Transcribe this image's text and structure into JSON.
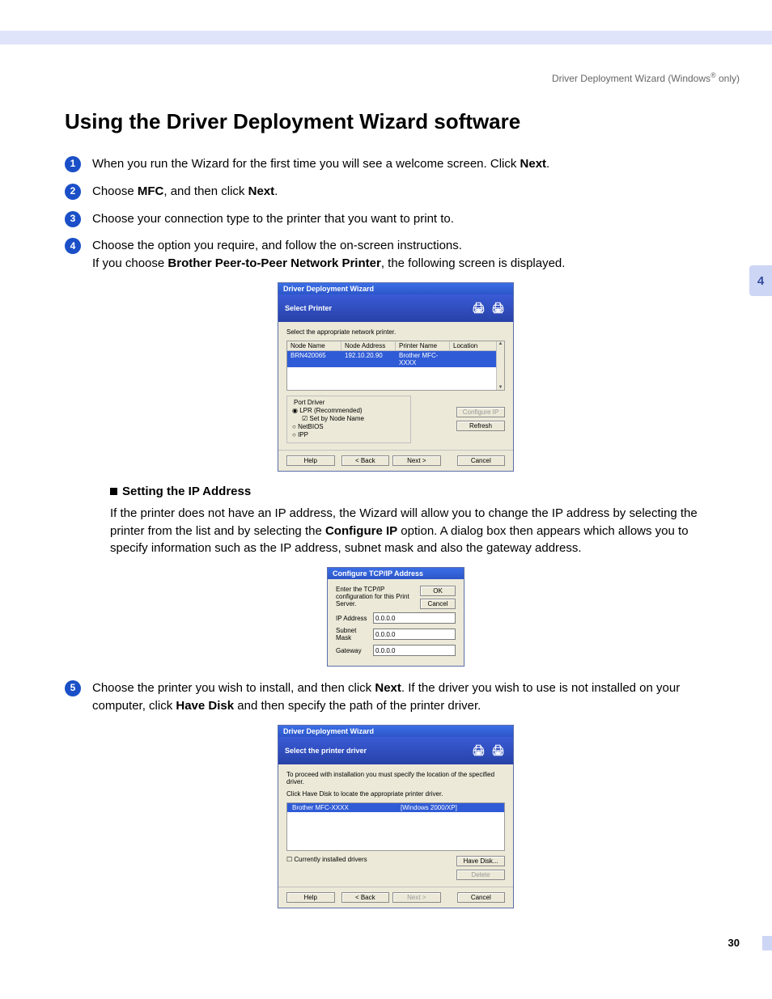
{
  "header": {
    "crumb_prefix": "Driver Deployment Wizard (Windows",
    "crumb_suffix": " only)",
    "reg": "®"
  },
  "title": "Using the Driver Deployment Wizard software",
  "steps": {
    "s1a": "When you run the Wizard for the first time you will see a welcome screen. Click ",
    "s1b": "Next",
    "s1c": ".",
    "s2a": "Choose ",
    "s2b": "MFC",
    "s2c": ", and then click ",
    "s2d": "Next",
    "s2e": ".",
    "s3": "Choose your connection type to the printer that you want to print to.",
    "s4a": "Choose the option you require, and follow the on-screen instructions.",
    "s4b": "If you choose ",
    "s4c": "Brother Peer-to-Peer Network Printer",
    "s4d": ", the following screen is displayed.",
    "s5a": "Choose the printer you wish to install, and then click ",
    "s5b": "Next",
    "s5c": ". If the driver you wish to use is not installed on your computer, click ",
    "s5d": "Have Disk",
    "s5e": " and then specify the path of the printer driver."
  },
  "sub": {
    "heading": "Setting the IP Address",
    "para_a": "If the printer does not have an IP address, the Wizard will allow you to change the IP address by selecting the printer from the list and by selecting the ",
    "para_b": "Configure IP",
    "para_c": " option. A dialog box then appears which allows you to specify information such as the IP address, subnet mask and also the gateway address."
  },
  "dlg1": {
    "title": "Driver Deployment Wizard",
    "banner": "Select Printer",
    "instr": "Select the appropriate network printer.",
    "cols": {
      "c1": "Node Name",
      "c2": "Node Address",
      "c3": "Printer Name",
      "c4": "Location"
    },
    "row": {
      "c1": "BRN420065",
      "c2": "192.10.20.90",
      "c3": "Brother   MFC-XXXX",
      "c4": ""
    },
    "fs": {
      "legend": "Port Driver",
      "o1": "LPR (Recommended)",
      "o2": "Set by Node Name",
      "o3": "NetBIOS",
      "o4": "IPP"
    },
    "btns": {
      "configip": "Configure IP",
      "refresh": "Refresh",
      "help": "Help",
      "back": "< Back",
      "next": "Next >",
      "cancel": "Cancel"
    }
  },
  "dlg2": {
    "title": "Configure TCP/IP Address",
    "msg": "Enter the TCP/IP configuration for this Print Server.",
    "ok": "OK",
    "cancel": "Cancel",
    "ip_lbl": "IP Address",
    "ip_val": "0.0.0.0",
    "sm_lbl": "Subnet Mask",
    "sm_val": "0.0.0.0",
    "gw_lbl": "Gateway",
    "gw_val": "0.0.0.0"
  },
  "dlg3": {
    "title": "Driver Deployment Wizard",
    "banner": "Select the printer driver",
    "instr1": "To proceed with installation you must specify the location of the specified driver.",
    "instr2": "Click Have Disk to locate the appropriate printer driver.",
    "row": {
      "c1": "Brother  MFC-XXXX",
      "c2": "[Windows 2000/XP]"
    },
    "chk": "Currently installed drivers",
    "btns": {
      "havedisk": "Have Disk...",
      "delete": "Delete",
      "help": "Help",
      "back": "< Back",
      "next": "Next >",
      "cancel": "Cancel"
    }
  },
  "sidetab": "4",
  "pagenum": "30",
  "nums": {
    "n1": "1",
    "n2": "2",
    "n3": "3",
    "n4": "4",
    "n5": "5"
  }
}
